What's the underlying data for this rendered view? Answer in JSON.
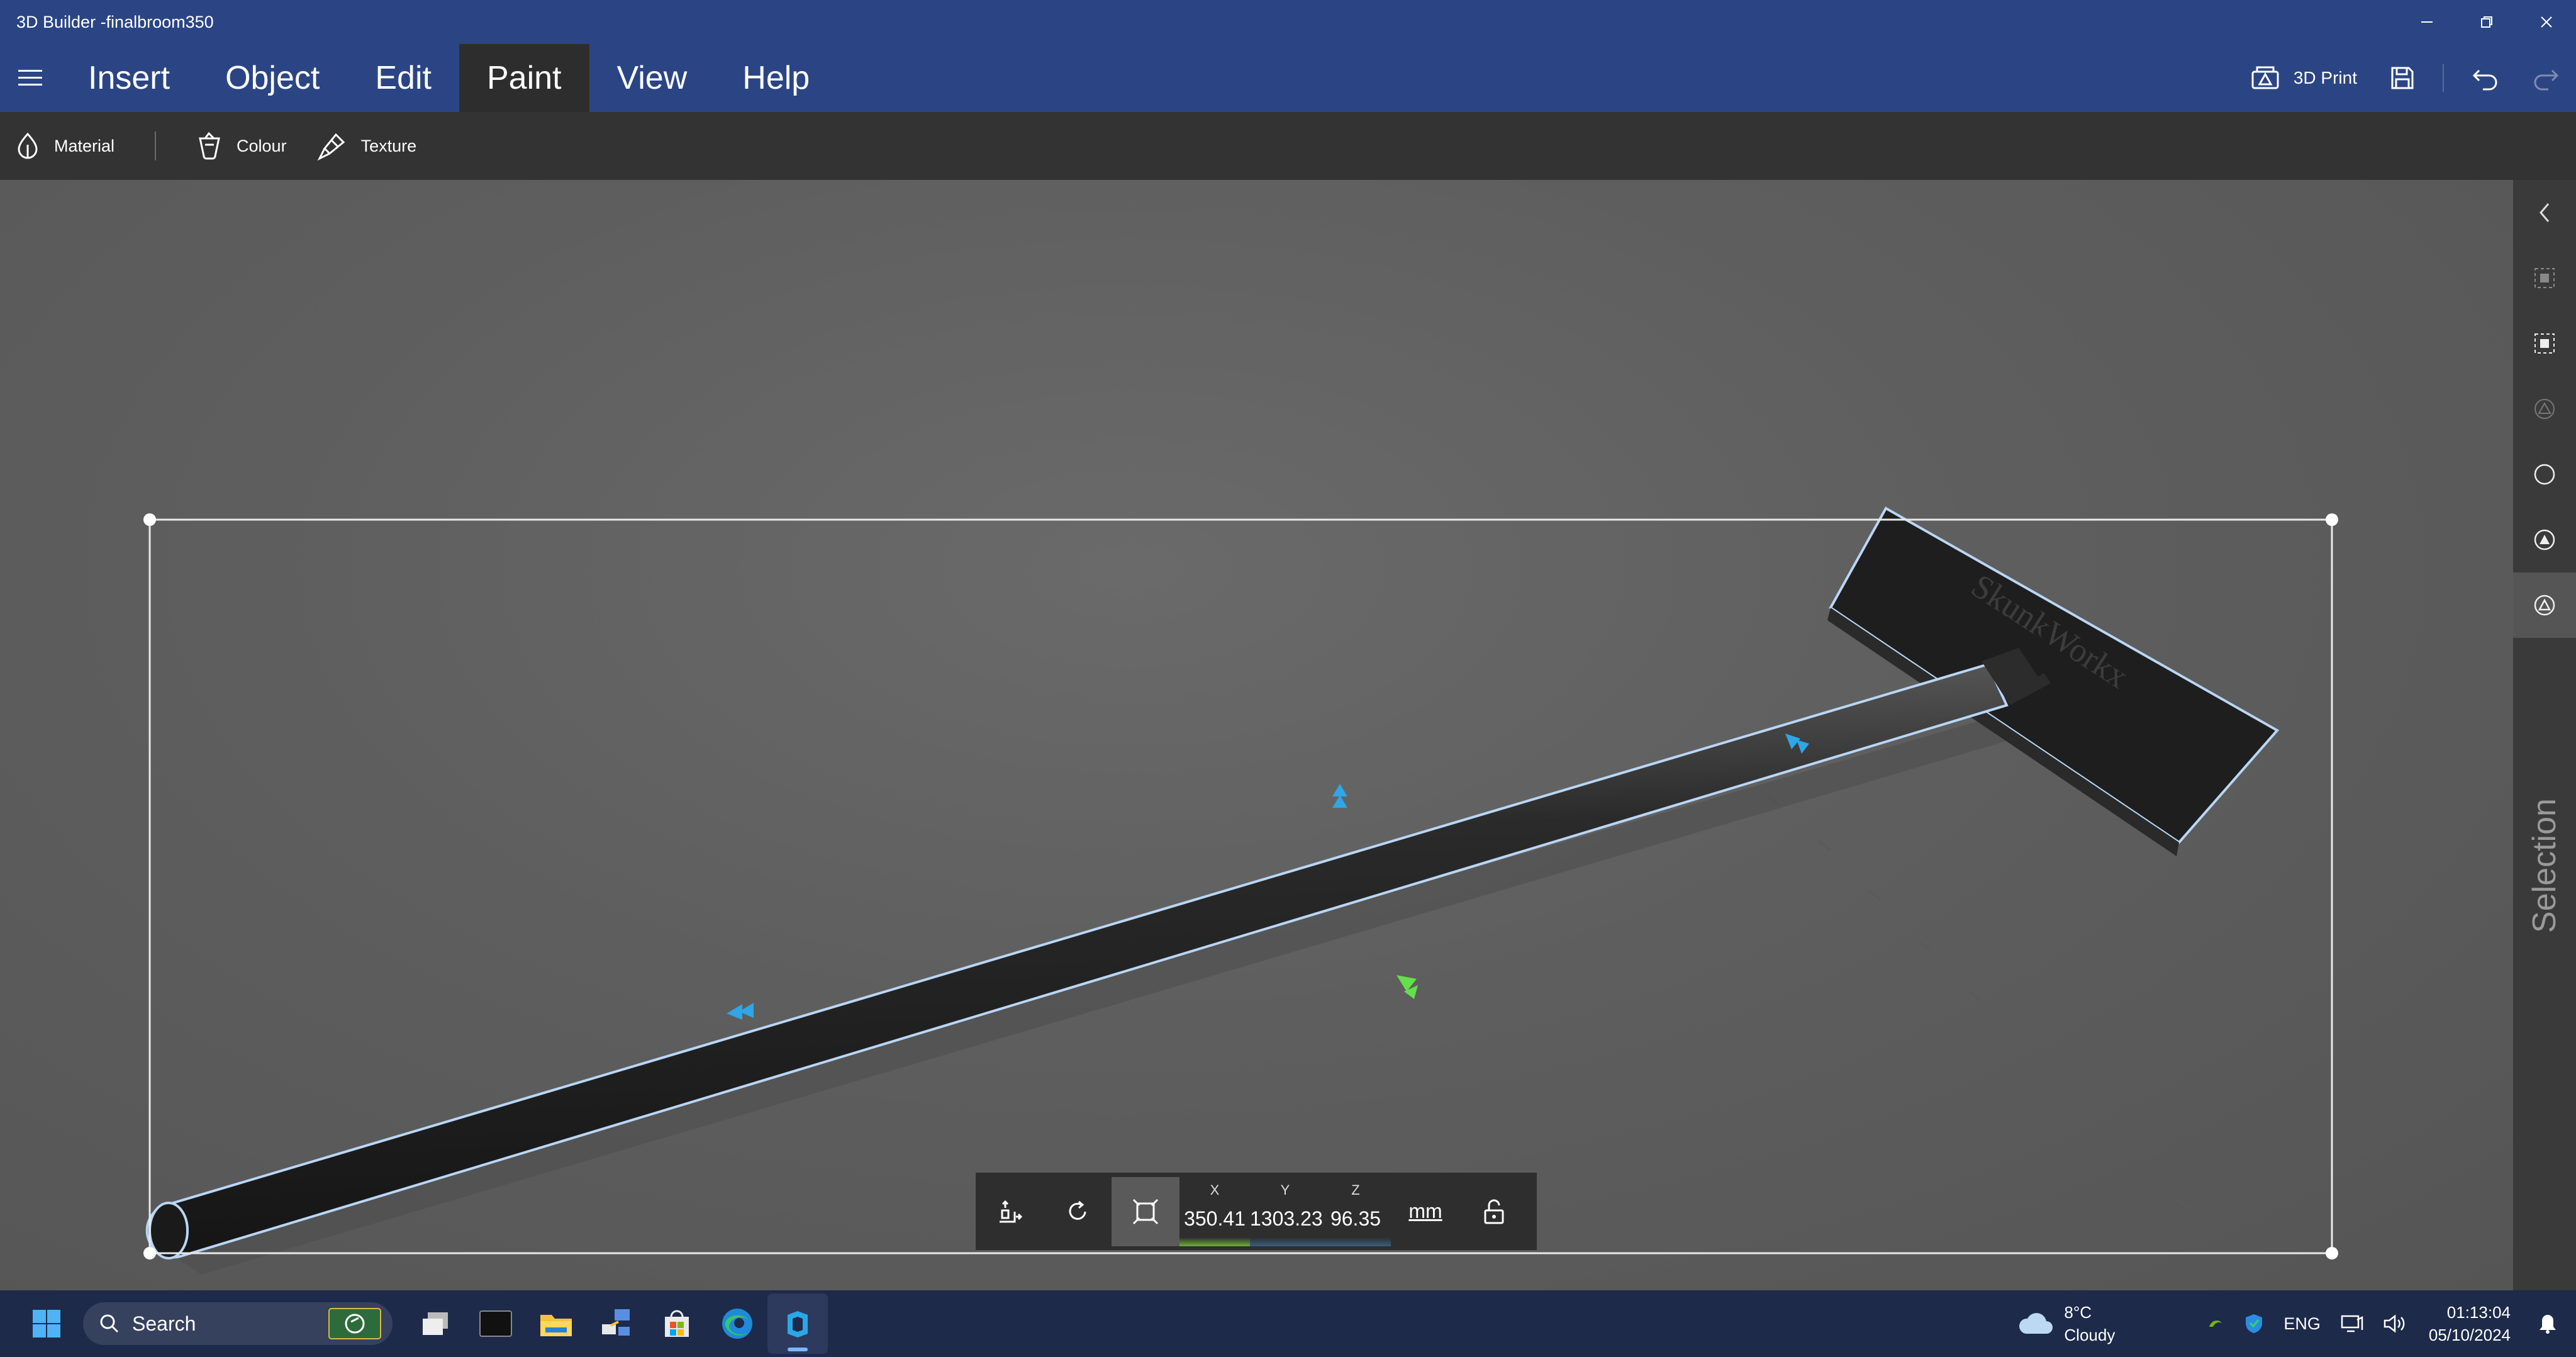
{
  "window": {
    "title": "3D Builder -finalbroom350",
    "controls": [
      "minimize-icon",
      "restore-icon",
      "close-icon"
    ]
  },
  "menu": {
    "items": [
      {
        "label": "Insert",
        "active": false
      },
      {
        "label": "Object",
        "active": false
      },
      {
        "label": "Edit",
        "active": false
      },
      {
        "label": "Paint",
        "active": true
      },
      {
        "label": "View",
        "active": false
      },
      {
        "label": "Help",
        "active": false
      }
    ],
    "print_label": "3D Print"
  },
  "toolbar": {
    "material": "Material",
    "colour": "Colour",
    "texture": "Texture"
  },
  "model": {
    "engraving": "SkunkWorkx"
  },
  "sidepanel": {
    "label": "Selection",
    "icons": [
      "chevron-left-icon",
      "select-object-icon",
      "select-group-icon",
      "select-mesh-icon",
      "select-circle-icon",
      "select-face-icon",
      "select-triangle-icon"
    ]
  },
  "dimensions": {
    "x_label": "X",
    "y_label": "Y",
    "z_label": "Z",
    "x": "350.41",
    "y": "1303.23",
    "z": "96.35",
    "unit": "mm",
    "colors": {
      "x": "#6fae3a",
      "y": "#3a6fae",
      "z": "#4a9ad6"
    }
  },
  "taskbar": {
    "search_placeholder": "Search",
    "weather_temp": "8°C",
    "weather_cond": "Cloudy",
    "language": "ENG",
    "time": "01:13:04",
    "date": "05/10/2024",
    "accent": "#1d2a4a"
  }
}
